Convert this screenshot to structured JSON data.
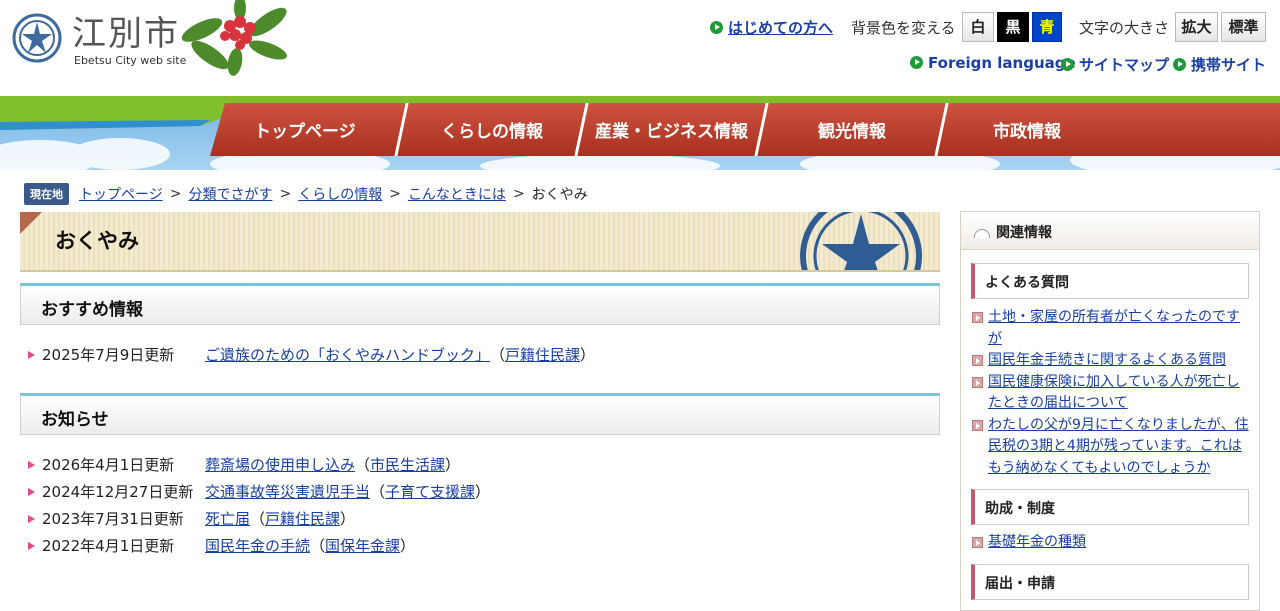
{
  "site": {
    "title": "江別市",
    "subtitle": "Ebetsu City web site"
  },
  "utility": {
    "first_visit": "はじめての方へ",
    "bg_label": "背景色を変える",
    "bg_white": "白",
    "bg_black": "黒",
    "bg_blue": "青",
    "font_label": "文字の大きさ",
    "font_large": "拡大",
    "font_standard": "標準",
    "foreign": "Foreign language",
    "sitemap": "サイトマップ",
    "mobile": "携帯サイト"
  },
  "nav": {
    "items": [
      "トップページ",
      "くらしの情報",
      "産業・ビジネス情報",
      "観光情報",
      "市政情報"
    ]
  },
  "breadcrumb": {
    "here": "現在地",
    "links": [
      "トップページ",
      "分類でさがす",
      "くらしの情報",
      "こんなときには"
    ],
    "sep": ">",
    "current": "おくやみ"
  },
  "main": {
    "title": "おくやみ",
    "recommended": {
      "heading": "おすすめ情報",
      "items": [
        {
          "date": "2025年7月9日更新",
          "title": "ご遺族のための「おくやみハンドブック」",
          "dept": "戸籍住民課"
        }
      ]
    },
    "news": {
      "heading": "お知らせ",
      "items": [
        {
          "date": "2026年4月1日更新",
          "title": "葬斎場の使用申し込み",
          "dept": "市民生活課"
        },
        {
          "date": "2024年12月27日更新",
          "title": "交通事故等災害遺児手当",
          "dept": "子育て支援課"
        },
        {
          "date": "2023年7月31日更新",
          "title": "死亡届",
          "dept": "戸籍住民課"
        },
        {
          "date": "2022年4月1日更新",
          "title": "国民年金の手続",
          "dept": "国保年金課"
        }
      ]
    },
    "paren_open": "（",
    "paren_close": "）"
  },
  "side": {
    "heading": "関連情報",
    "faq": {
      "heading": "よくある質問",
      "links": [
        "土地・家屋の所有者が亡くなったのですが",
        "国民年金手続きに関するよくある質問",
        "国民健康保険に加入している人が死亡したときの届出について",
        "わたしの父が9月に亡くなりましたが、住民税の3期と4期が残っています。これはもう納めなくてもよいのでしょうか"
      ]
    },
    "support": {
      "heading": "助成・制度",
      "links": [
        "基礎年金の種類"
      ]
    },
    "forms": {
      "heading": "届出・申請"
    }
  },
  "colors": {
    "nav_red": "#b93a2e",
    "link_blue": "#1a3fa6",
    "section_accent": "#7cc3de",
    "side_accent": "#c2596f",
    "bullet_pink": "#e8478a"
  }
}
